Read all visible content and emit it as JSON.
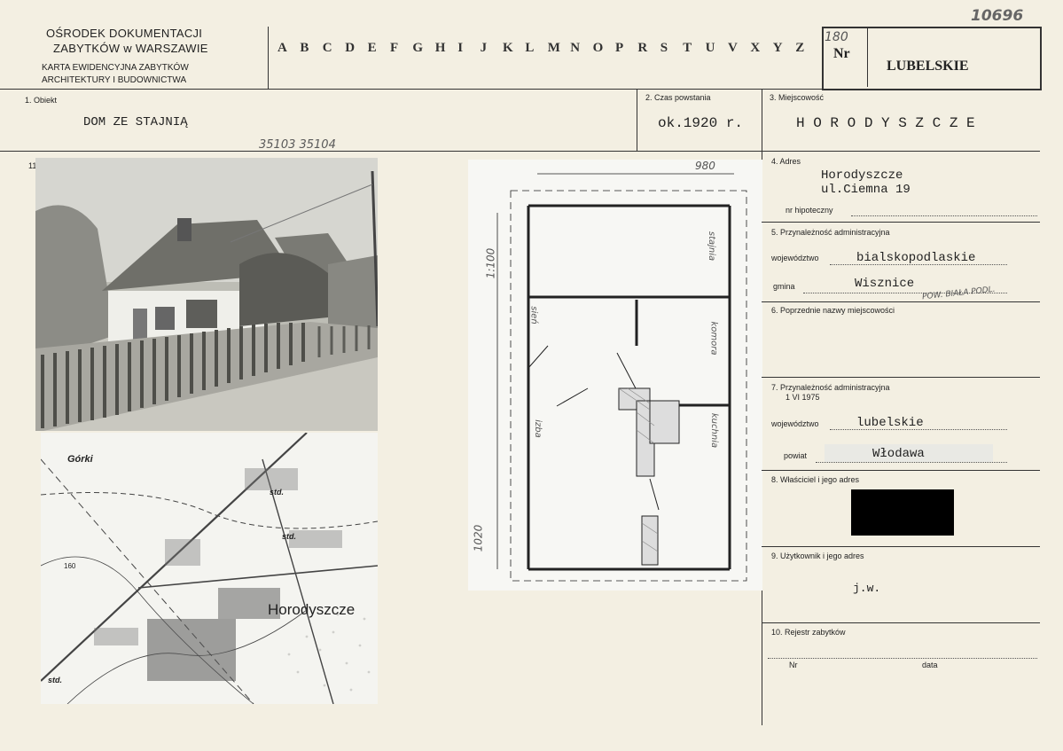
{
  "header": {
    "institution_line1": "OŚRODEK DOKUMENTACJI",
    "institution_line2": "ZABYTKÓW w WARSZAWIE",
    "card_type_line1": "KARTA EWIDENCYJNA ZABYTKÓW",
    "card_type_line2": "ARCHITEKTURY I BUDOWNICTWA",
    "alphabet": [
      "A",
      "B",
      "C",
      "D",
      "E",
      "F",
      "G",
      "H",
      "I",
      "J",
      "K",
      "L",
      "M",
      "N",
      "O",
      "P",
      "R",
      "S",
      "T",
      "U",
      "V",
      "X",
      "Y",
      "Z"
    ],
    "nr_label": "Nr",
    "nr_handwritten": "180",
    "region": "LUBELSKIE",
    "archive_number": "10696"
  },
  "fields": {
    "object_label": "1.  Obiekt",
    "object_value": "DOM ZE STAJNIĄ",
    "date_label": "2.  Czas powstania",
    "date_value": "ok.1920 r.",
    "place_label": "3.  Miejscowość",
    "place_value": "H O R O D Y S Z C Z E",
    "photo_numbers": "35103  35104",
    "section_11": "11",
    "address_label": "4.  Adres",
    "address_line1": "Horodyszcze",
    "address_line2": "ul.Ciemna 19",
    "mortgage_label": "nr hipoteczny",
    "admin_label": "5.  Przynależność administracyjna",
    "voivodeship_label": "województwo",
    "voivodeship_value": "bialskopodlaskie",
    "commune_label": "gmina",
    "commune_value": "Wisznice",
    "commune_note": "POW. BIAŁA PODL.",
    "former_names_label": "6.  Poprzednie nazwy miejscowości",
    "admin1975_label": "7.  Przynależność administracyjna",
    "admin1975_sub": "1 VI 1975",
    "voivodeship1975_label": "województwo",
    "voivodeship1975_value": "lubelskie",
    "district_label": "powiat",
    "district_value": "Włodawa",
    "owner_label": "8.  Właściciel i jego adres",
    "user_label": "9.  Użytkownik i jego adres",
    "user_value": "j.w.",
    "registry_label": "10.  Rejestr zabytków",
    "registry_nr_label": "Nr",
    "registry_date_label": "data"
  },
  "map": {
    "label_gorki": "Górki",
    "label_town": "Horodyszcze",
    "label_std1": "std.",
    "label_std2": "std.",
    "label_std3": "std.",
    "label_160": "160"
  },
  "plan": {
    "dim_width": "980",
    "dim_height": "1020",
    "scale": "1:100",
    "room1": "stajnia",
    "room2": "komora",
    "room3": "sień",
    "room4": "izba",
    "room5": "kuchnia"
  }
}
